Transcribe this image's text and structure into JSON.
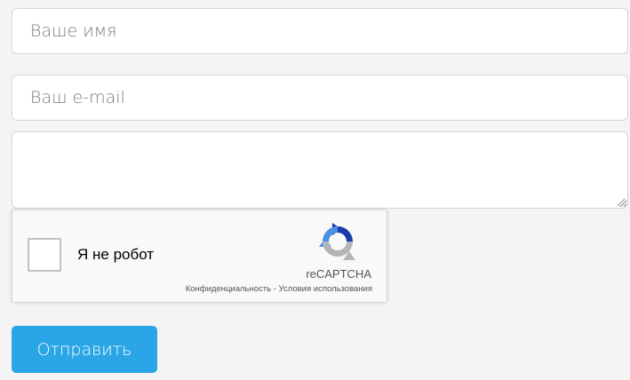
{
  "form": {
    "name_placeholder": "Ваше имя",
    "email_placeholder": "Ваш e-mail",
    "message_placeholder": "",
    "submit_label": "Отправить"
  },
  "captcha": {
    "checkbox_label": "Я не робот",
    "brand": "reCAPTCHA",
    "privacy_link": "Конфиденциальность",
    "separator": " - ",
    "terms_link": "Условия использования",
    "logo_icon": "recaptcha-logo-icon"
  },
  "colors": {
    "background": "#f4f4f4",
    "field_border": "#d6d6d6",
    "button": "#2aa5e6",
    "button_text": "#ffffff",
    "recaptcha_blue": "#4a90e2",
    "recaptcha_dark_blue": "#1c3aa9",
    "recaptcha_gray": "#b5b5b5"
  }
}
